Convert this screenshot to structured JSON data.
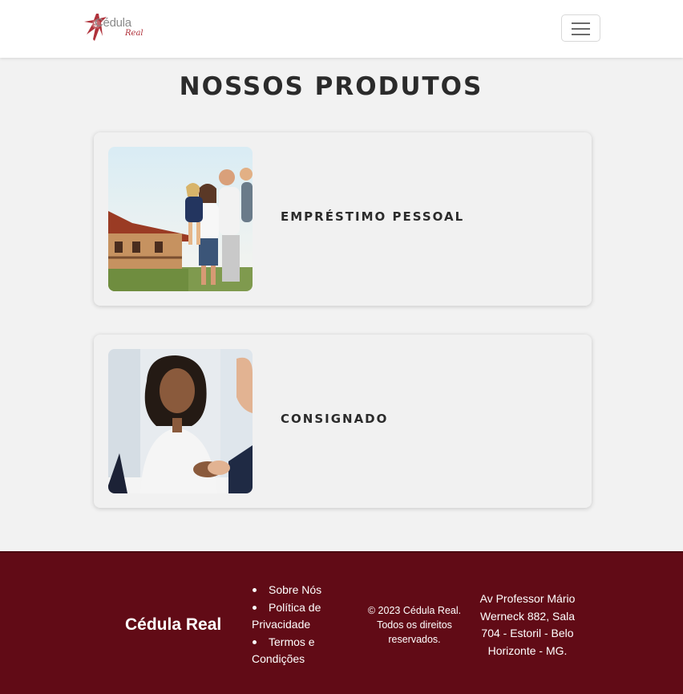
{
  "header": {
    "logo": {
      "text": "Cédula",
      "subtext": "Real",
      "accent_color": "#b0323b"
    },
    "menu_icon": "hamburger-menu-icon"
  },
  "main": {
    "title": "NOSSOS PRODUTOS",
    "products": [
      {
        "title": "EMPRÉSTIMO PESSOAL",
        "image": "family-photo"
      },
      {
        "title": "CONSIGNADO",
        "image": "handshake-photo"
      }
    ]
  },
  "footer": {
    "background_color": "#610b16",
    "brand": "Cédula Real",
    "links": [
      {
        "label": "Sobre Nós"
      },
      {
        "label": "Política de Privacidade"
      },
      {
        "label": "Termos e Condições"
      }
    ],
    "copyright": "© 2023 Cédula Real. Todos os direitos reservados.",
    "address": "Av Professor Mário Werneck 882, Sala 704 - Estoril - Belo Horizonte - MG."
  }
}
